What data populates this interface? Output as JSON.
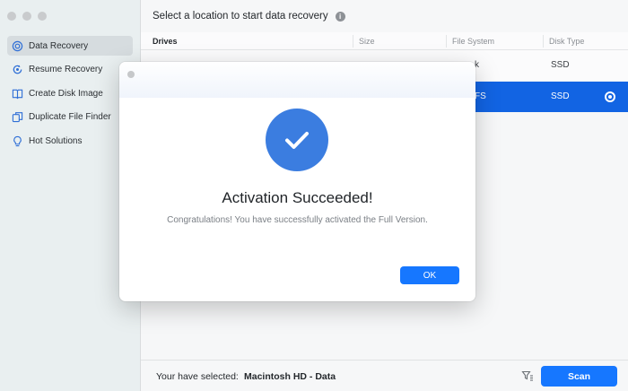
{
  "sidebar": {
    "items": [
      {
        "label": "Data Recovery",
        "icon": "target-icon"
      },
      {
        "label": "Resume Recovery",
        "icon": "resume-icon"
      },
      {
        "label": "Create Disk Image",
        "icon": "book-icon"
      },
      {
        "label": "Duplicate File Finder",
        "icon": "copy-icon"
      },
      {
        "label": "Hot Solutions",
        "icon": "lightbulb-icon"
      }
    ]
  },
  "header": {
    "title": "Select a location to start data recovery"
  },
  "table": {
    "columns": {
      "drives": "Drives",
      "size": "Size",
      "file_system": "File System",
      "disk_type": "Disk Type"
    },
    "rows": [
      {
        "file_system": "k",
        "disk_type": "SSD"
      },
      {
        "file_system": "FS",
        "disk_type": "SSD"
      }
    ]
  },
  "footer": {
    "selected_label": "Your have selected:",
    "selected_value": "Macintosh HD - Data",
    "scan_label": "Scan"
  },
  "dialog": {
    "title": "Activation Succeeded!",
    "message": "Congratulations! You have successfully activated the Full Version.",
    "ok_label": "OK"
  },
  "colors": {
    "accent": "#1677ff",
    "selected_row": "#1264e3",
    "success_circle": "#3b7de0"
  }
}
